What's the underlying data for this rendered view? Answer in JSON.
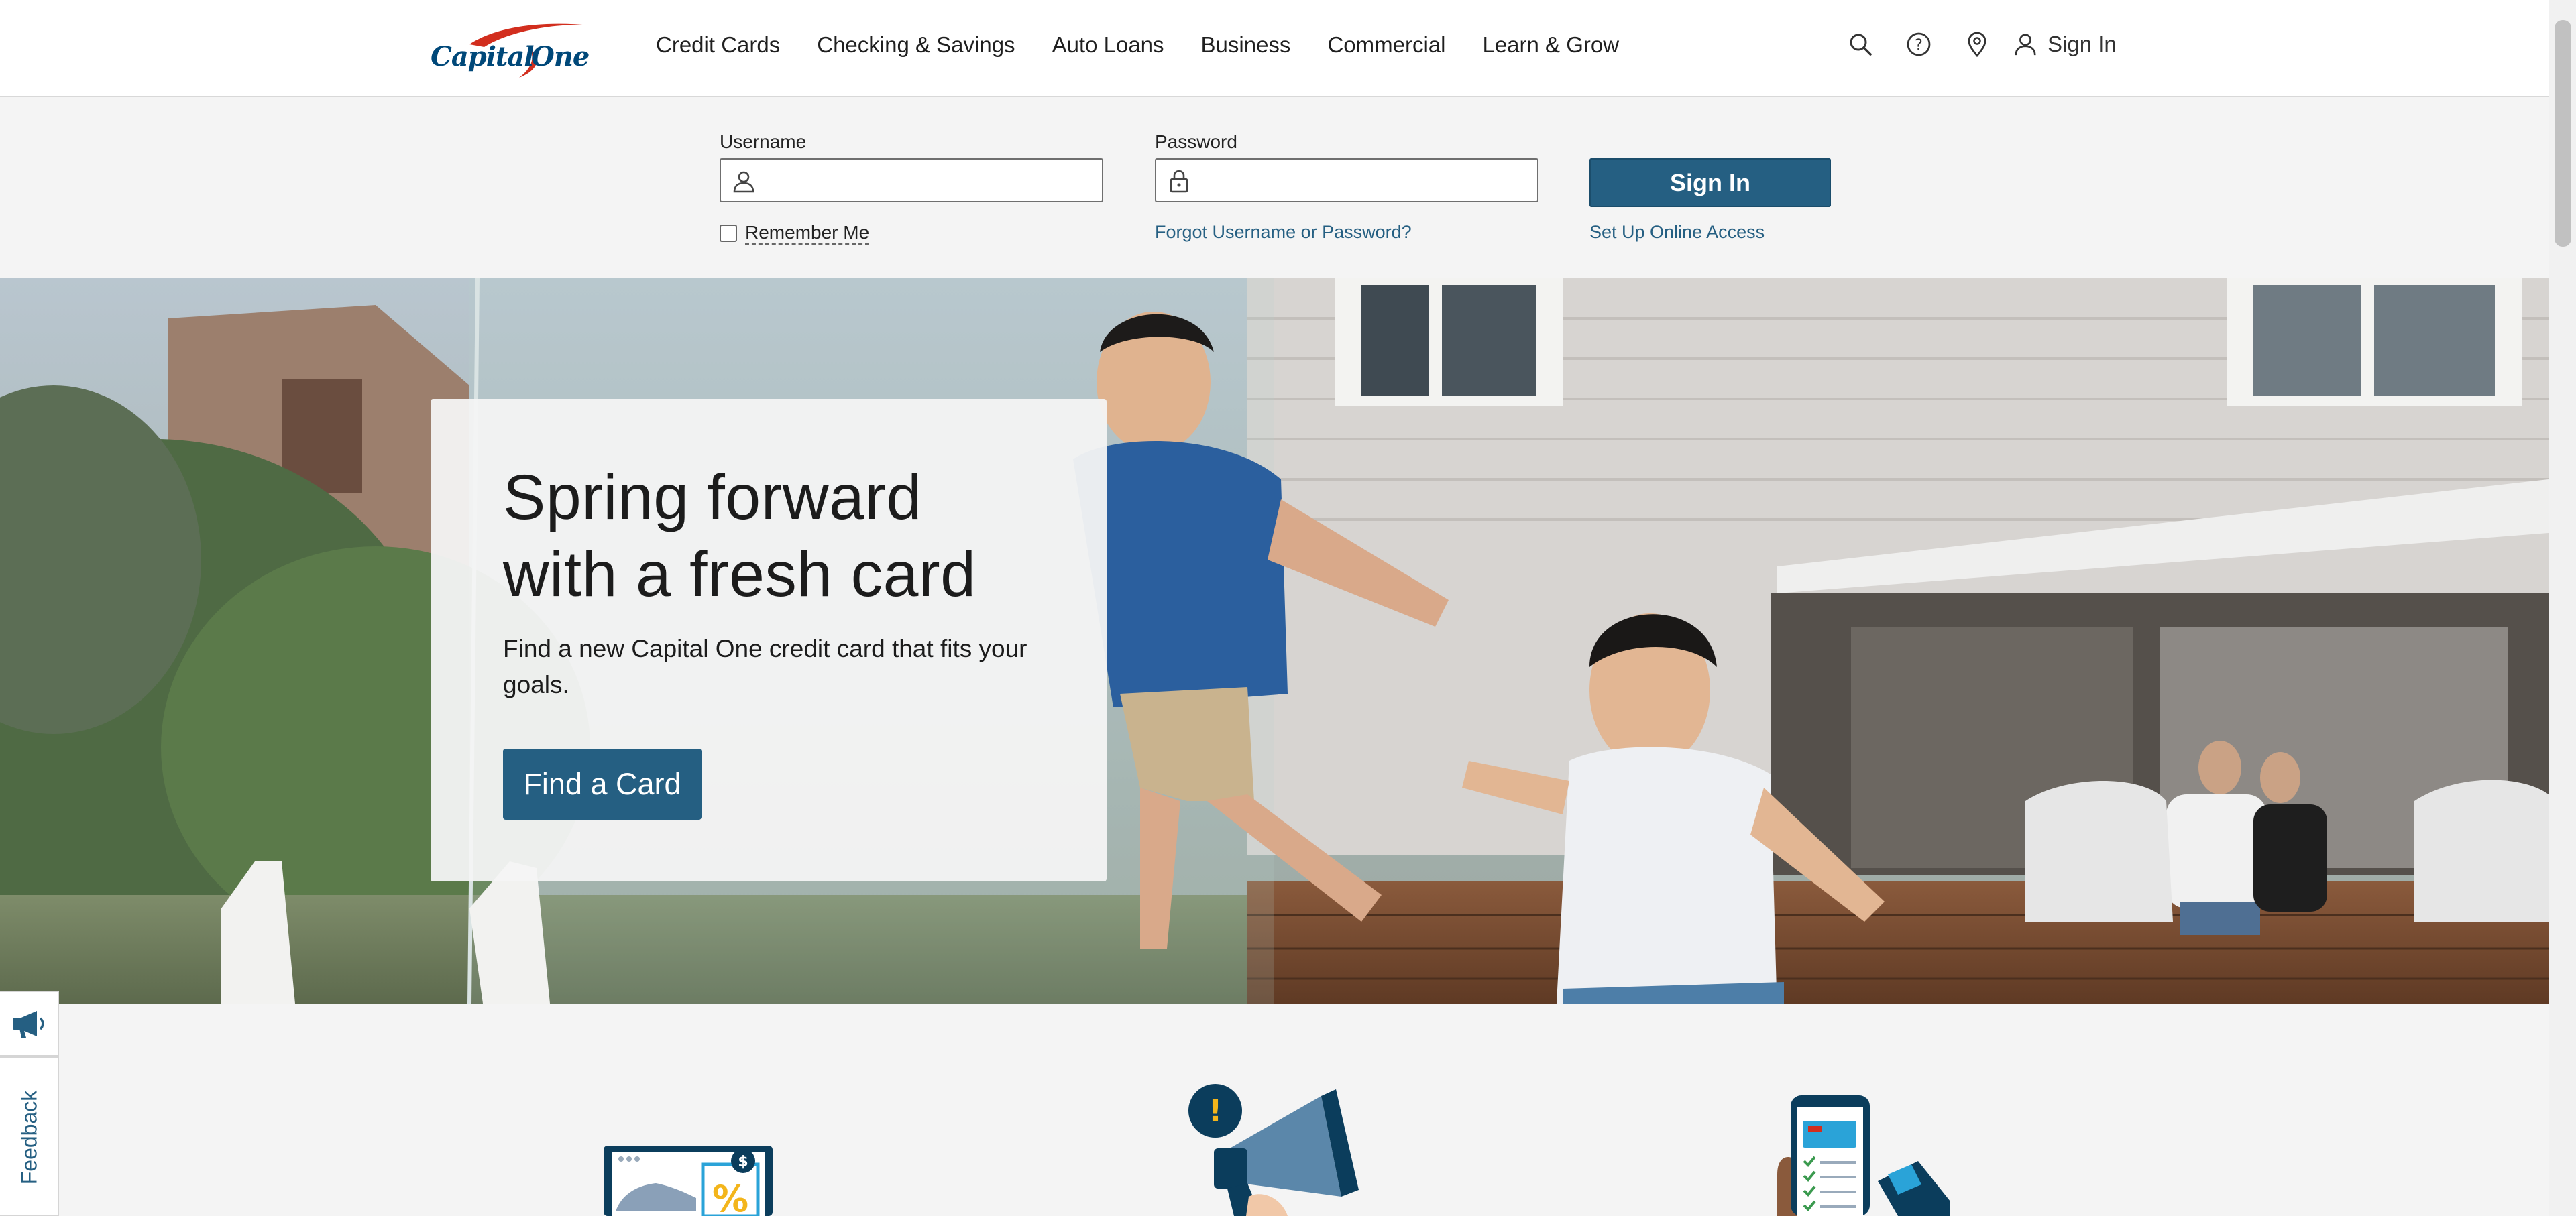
{
  "header": {
    "brand": "Capital One",
    "nav": [
      {
        "label": "Credit Cards"
      },
      {
        "label": "Checking & Savings"
      },
      {
        "label": "Auto Loans"
      },
      {
        "label": "Business"
      },
      {
        "label": "Commercial"
      },
      {
        "label": "Learn & Grow"
      }
    ],
    "utility": {
      "icons": [
        "search-icon",
        "help-icon",
        "location-icon",
        "user-icon"
      ],
      "sign_in_label": "Sign In"
    }
  },
  "login": {
    "username_label": "Username",
    "username_value": "",
    "password_label": "Password",
    "password_value": "",
    "remember_label": "Remember Me",
    "remember_checked": false,
    "forgot_link": "Forgot Username or Password?",
    "signin_button": "Sign In",
    "setup_link": "Set Up Online Access"
  },
  "hero": {
    "title": "Spring forward with a fresh card",
    "subtitle": "Find a new Capital One credit card that fits your goals.",
    "cta": "Find a Card"
  },
  "feedback": {
    "label": "Feedback",
    "icon": "megaphone-icon"
  },
  "colors": {
    "brand_blue": "#255f82",
    "logo_red": "#d22e1e",
    "logo_navy": "#004879",
    "accent_yellow": "#f3b51b"
  }
}
